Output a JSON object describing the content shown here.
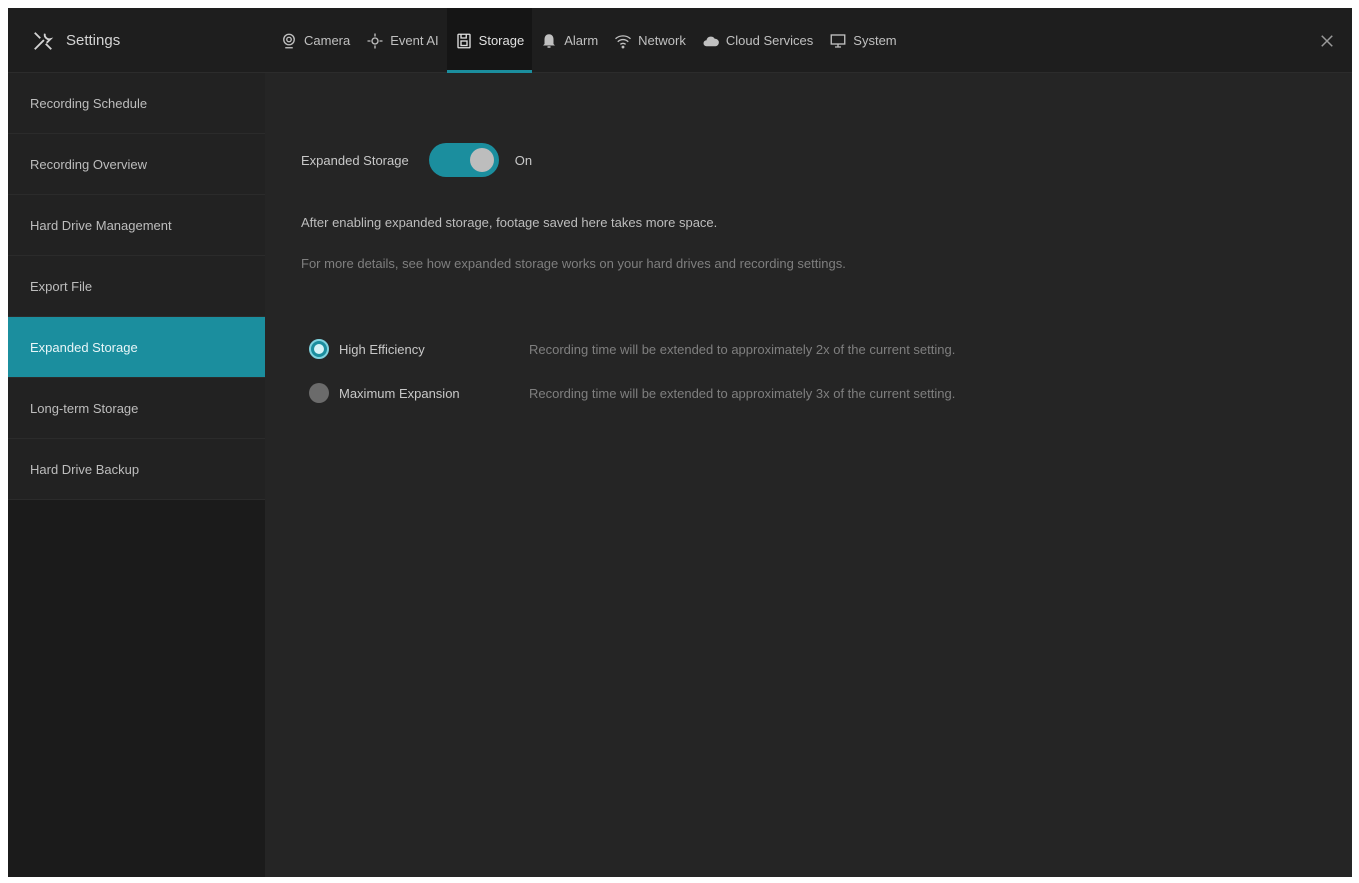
{
  "header": {
    "title": "Settings",
    "tabs": [
      {
        "label": "Camera",
        "icon": "camera-icon"
      },
      {
        "label": "Event AI",
        "icon": "event-ai-icon"
      },
      {
        "label": "Storage",
        "icon": "storage-icon"
      },
      {
        "label": "Alarm",
        "icon": "alarm-icon"
      },
      {
        "label": "Network",
        "icon": "network-icon"
      },
      {
        "label": "Cloud Services",
        "icon": "cloud-icon"
      },
      {
        "label": "System",
        "icon": "system-icon"
      }
    ],
    "active_tab": "Storage"
  },
  "sidebar": {
    "items": [
      {
        "label": "Recording Schedule"
      },
      {
        "label": "Recording Overview"
      },
      {
        "label": "Hard Drive Management"
      },
      {
        "label": "Export File"
      },
      {
        "label": "Expanded Storage"
      },
      {
        "label": "Long-term Storage"
      },
      {
        "label": "Hard Drive Backup"
      }
    ],
    "active_index": 4
  },
  "main": {
    "toggle": {
      "label": "Expanded Storage",
      "state": "On",
      "enabled": true
    },
    "description": "After enabling expanded storage, footage saved here takes more space.",
    "hint": "For more details, see how expanded storage works on your hard drives and recording settings.",
    "options": [
      {
        "label": "High Efficiency",
        "description": "Recording time will be extended to approximately 2x of the current setting.",
        "selected": true
      },
      {
        "label": "Maximum Expansion",
        "description": "Recording time will be extended to approximately 3x of the current setting.",
        "selected": false
      }
    ]
  },
  "colors": {
    "accent": "#1b8e9e",
    "background": "#252525",
    "sidebar": "#1b1b1b"
  }
}
